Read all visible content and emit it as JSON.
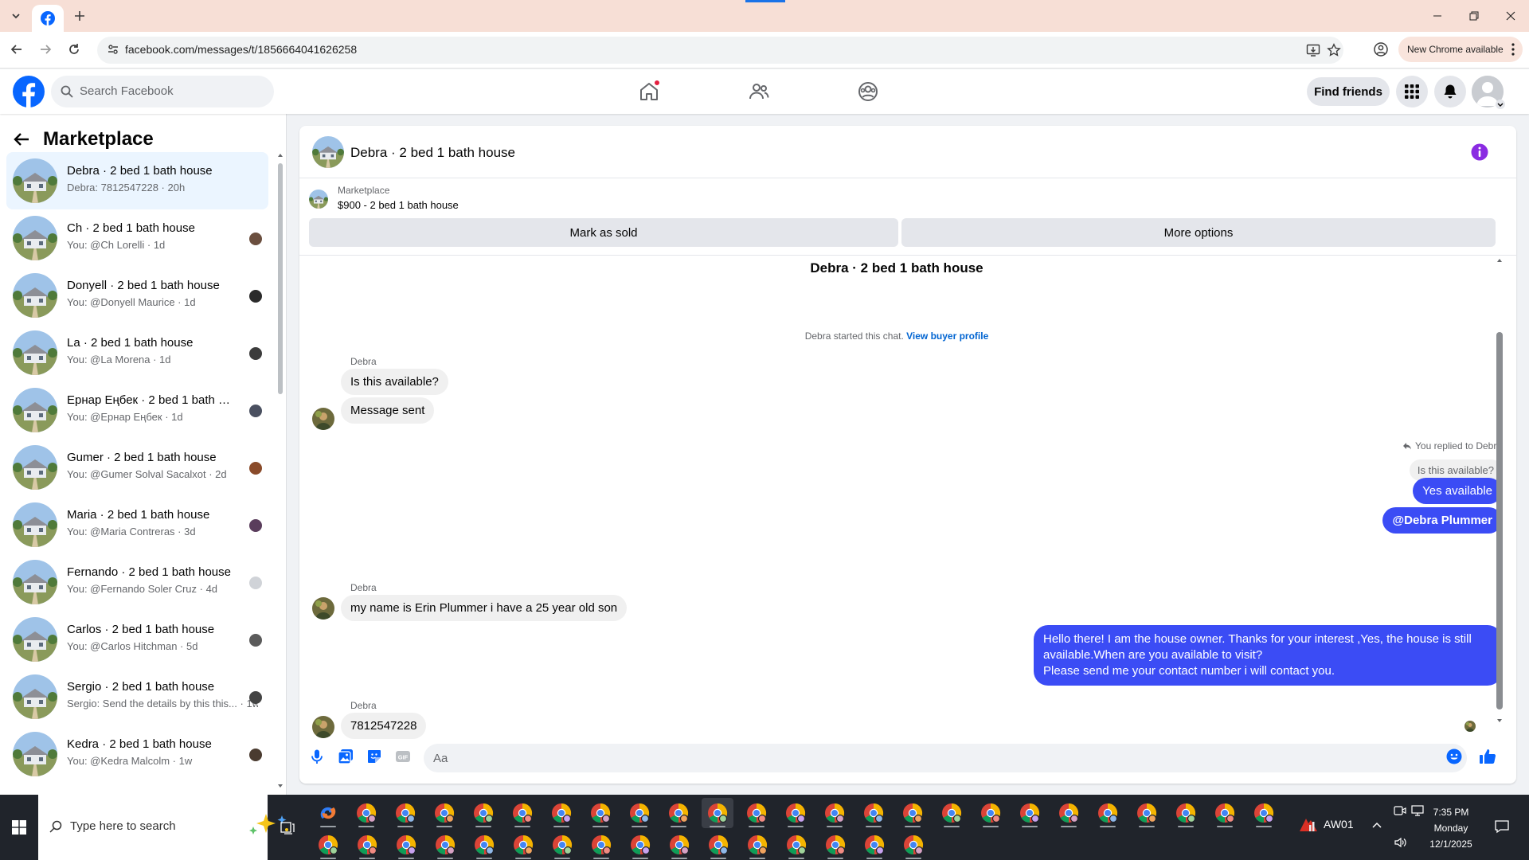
{
  "browser": {
    "url": "facebook.com/messages/t/1856664041626258",
    "new_chrome": "New Chrome available"
  },
  "fb": {
    "search_placeholder": "Search Facebook",
    "find_friends": "Find friends"
  },
  "sidebar": {
    "title": "Marketplace",
    "conversations": [
      {
        "name": "Debra · 2 bed 1 bath house",
        "sub": "Debra: 7812547228 · 20h",
        "active": true
      },
      {
        "name": "Ch · 2 bed 1 bath house",
        "sub": "You: @Ch Lorelli · 1d"
      },
      {
        "name": "Donyell · 2 bed 1 bath house",
        "sub": "You: @Donyell Maurice · 1d"
      },
      {
        "name": "La · 2 bed 1 bath house",
        "sub": "You: @La Morena · 1d"
      },
      {
        "name": "Ернар Еңбек · 2 bed 1 bath h...",
        "sub": "You: @Ернар Еңбек · 1d"
      },
      {
        "name": "Gumer · 2 bed 1 bath house",
        "sub": "You: @Gumer Solval Sacalxot · 2d"
      },
      {
        "name": "Maria · 2 bed 1 bath house",
        "sub": "You: @Maria Contreras · 3d"
      },
      {
        "name": "Fernando · 2 bed 1 bath house",
        "sub": "You: @Fernando Soler Cruz · 4d"
      },
      {
        "name": "Carlos · 2 bed 1 bath house",
        "sub": "You: @Carlos Hitchman · 5d"
      },
      {
        "name": "Sergio · 2 bed 1 bath house",
        "sub": "Sergio: Send the details by this this... · 1w"
      },
      {
        "name": "Kedra · 2 bed 1 bath house",
        "sub": "You: @Kedra Malcolm · 1w"
      }
    ]
  },
  "chat": {
    "title": "Debra · 2 bed 1 bath house",
    "listing_label": "Marketplace",
    "listing_price": "$900 - 2 bed 1 bath house",
    "mark_sold": "Mark as sold",
    "more_options": "More options",
    "conv_title": "Debra · 2 bed 1 bath house",
    "started_text": "Debra started this chat.",
    "view_profile": "View buyer profile",
    "sender": "Debra",
    "msg1": "Is this available?",
    "msg2": "Message sent",
    "reply_note": "You replied to Debra",
    "reply_quote": "Is this available?",
    "out1": "Yes available",
    "out2": "@Debra Plummer",
    "msg3": "my name is Erin Plummer i have a 25 year old son",
    "out_long_1": "Hello there! I am the house owner. Thanks for your interest ,Yes, the house is still available.When are you available to visit?",
    "out_long_2": "Please send me your contact number i will contact you.",
    "msg4": "7812547228",
    "input_placeholder": "Aa"
  },
  "taskbar": {
    "search_placeholder": "Type here to search",
    "tray_app": "AW01",
    "time": "7:35 PM",
    "day": "Monday",
    "date": "12/1/2025"
  },
  "colors": {
    "fb_blue": "#0866ff",
    "bubble_out": "#3b4cf5",
    "info_purple": "#8a2be2"
  }
}
